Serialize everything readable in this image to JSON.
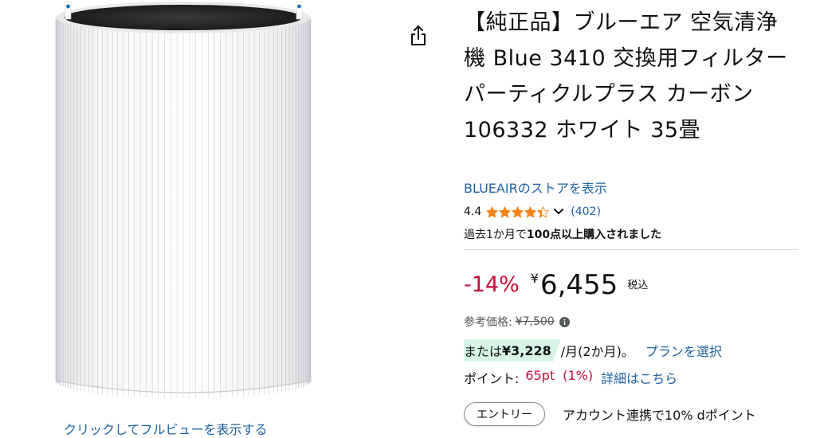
{
  "product": {
    "title": "【純正品】ブルーエア 空気清浄機 Blue 3410 交換用フィルター パーティクルプラス カーボン 106332 ホワイト 35畳",
    "store_link": "BLUEAIRのストアを表示",
    "view_full_link": "クリックしてフルビューを表示する",
    "image_icon": "pleated-cylindrical-filter"
  },
  "share": {
    "icon": "share-icon"
  },
  "rating": {
    "value": "4.4",
    "stars": 4.4,
    "review_count": "(402)",
    "star_color": "#f3841b"
  },
  "purchase": {
    "prefix": "過去1か月で",
    "highlight": "100点以上購入されました"
  },
  "price": {
    "discount": "-14%",
    "currency": "¥",
    "amount": "6,455",
    "tax": "税込",
    "ref_label": "参考価格:",
    "ref_value": "¥7,500",
    "discount_color": "#cc0c39"
  },
  "installment": {
    "prefix": "または",
    "amount": "¥3,228",
    "period": "/月(2か月)。",
    "select_plan": "プランを選択",
    "badge_color": "#d7f4e7"
  },
  "points": {
    "label": "ポイント:",
    "value": "65pt",
    "percent": "(1%)",
    "details_link": "詳細はこちら"
  },
  "entry": {
    "button": "エントリー",
    "text": "アカウント連携で10% dポイント"
  },
  "colors": {
    "link": "#2162a1",
    "text": "#0f1111",
    "muted": "#565959"
  }
}
